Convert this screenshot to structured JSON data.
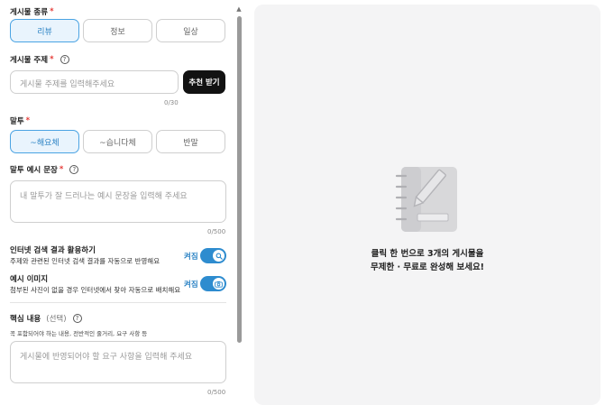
{
  "post_type": {
    "label": "게시물 종류",
    "required_mark": "*",
    "options": [
      "리뷰",
      "정보",
      "일상"
    ],
    "selected": "리뷰"
  },
  "topic": {
    "label": "게시물 주제",
    "required_mark": "*",
    "placeholder": "게시물 주제를 입력해주세요",
    "counter": "0/30",
    "recommend_button": "추천 받기"
  },
  "tone": {
    "label": "말투",
    "required_mark": "*",
    "options": [
      "~해요체",
      "~습니다체",
      "반말"
    ],
    "selected": "~해요체"
  },
  "tone_example": {
    "label": "말투 예시 문장",
    "required_mark": "*",
    "placeholder": "내 말투가 잘 드러나는 예시 문장을 입력해 주세요",
    "counter": "0/500"
  },
  "web_search": {
    "title": "인터넷 검색 결과 활용하기",
    "description": "주제와 관련된 인터넷 검색 결과를 자동으로 반영해요",
    "state_label": "켜짐",
    "icon": "search-icon"
  },
  "example_image": {
    "title": "예시 이미지",
    "description": "첨부된 사진이 없을 경우 인터넷에서 찾아 자동으로 배치해요",
    "state_label": "켜짐",
    "icon": "camera-icon"
  },
  "key_content": {
    "label": "핵심 내용",
    "optional_label": "(선택)",
    "description": "꼭 포함되어야 하는 내용, 전반적인 줄거리, 요구 사항 등",
    "placeholder": "게시물에 반영되어야 할 요구 사항을 입력해 주세요",
    "counter": "0/500"
  },
  "preview": {
    "icon": "write-document-icon",
    "message_line1": "클릭 한 번으로 3개의 게시물을",
    "message_line2": "무제한 · 무료로 완성해 보세요!"
  },
  "colors": {
    "accent": "#2e8ccf",
    "selected_bg": "#e9f4fd",
    "required": "#e53935",
    "dark_button": "#121212",
    "preview_bg": "#f4f4f5"
  }
}
